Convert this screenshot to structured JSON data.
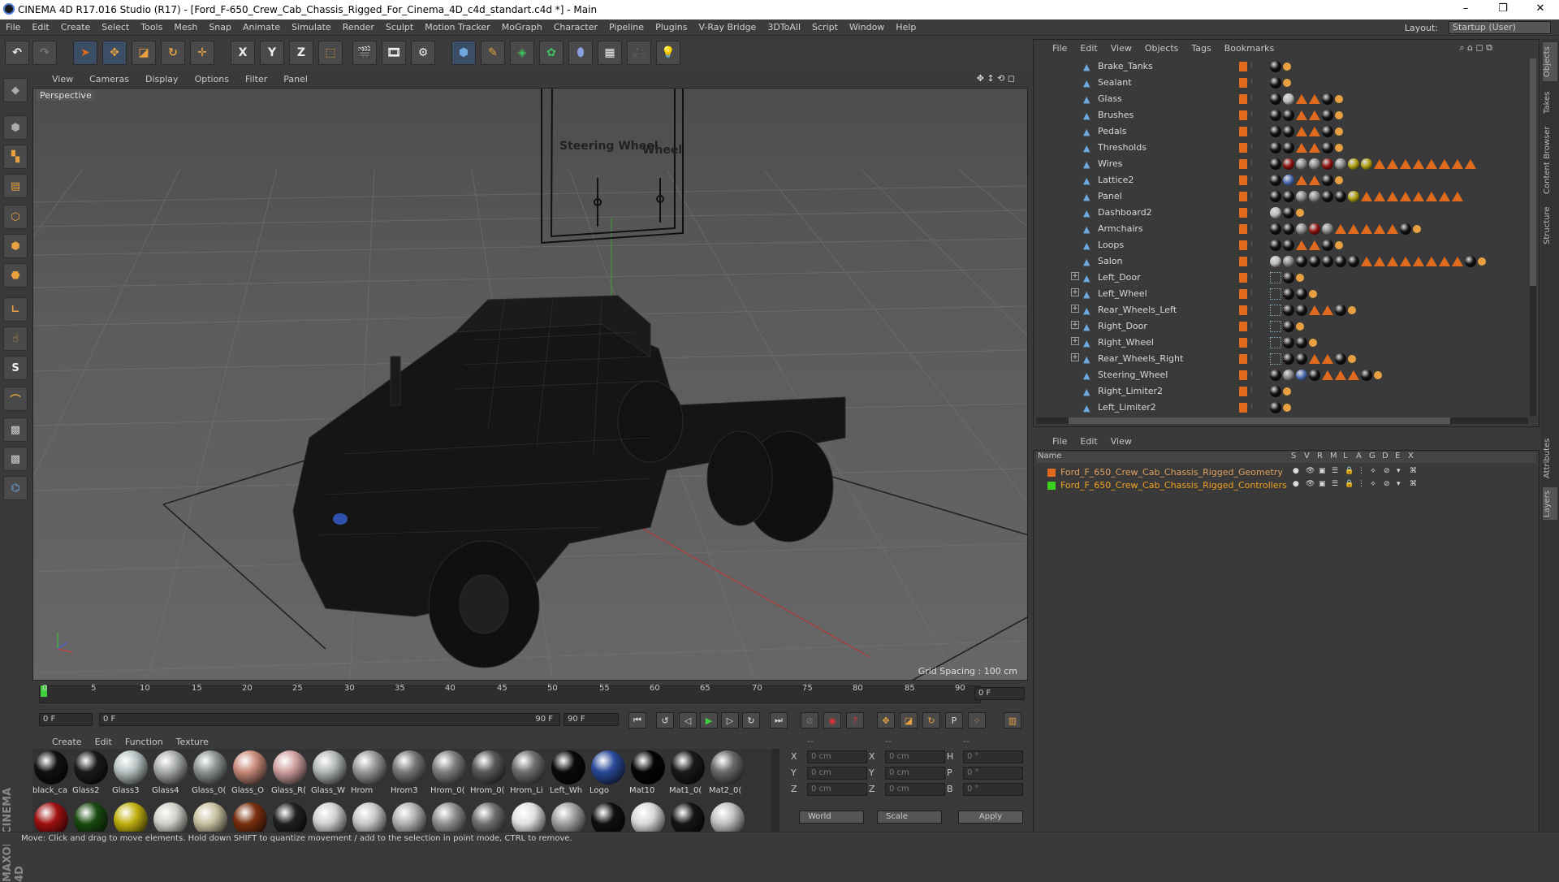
{
  "window": {
    "title": "CINEMA 4D R17.016 Studio (R17) - [Ford_F-650_Crew_Cab_Chassis_Rigged_For_Cinema_4D_c4d_standart.c4d *] - Main",
    "minimize": "–",
    "maximize": "❐",
    "close": "✕"
  },
  "menubar": {
    "items": [
      "File",
      "Edit",
      "Create",
      "Select",
      "Tools",
      "Mesh",
      "Snap",
      "Animate",
      "Simulate",
      "Render",
      "Sculpt",
      "Motion Tracker",
      "MoGraph",
      "Character",
      "Pipeline",
      "Plugins",
      "V-Ray Bridge",
      "3DToAll",
      "Script",
      "Window",
      "Help"
    ],
    "layout_label": "Layout:",
    "layout_value": "Startup (User)"
  },
  "toolbar": {
    "axis_x": "X",
    "axis_y": "Y",
    "axis_z": "Z"
  },
  "viewport": {
    "menu": [
      "View",
      "Cameras",
      "Display",
      "Options",
      "Filter",
      "Panel"
    ],
    "camera_label": "Perspective",
    "grid_spacing": "Grid Spacing : 100 cm",
    "sign_left": "Steering Wheel",
    "sign_right": "Wheel"
  },
  "timeline": {
    "ticks": [
      "0",
      "5",
      "10",
      "15",
      "20",
      "25",
      "30",
      "35",
      "40",
      "45",
      "50",
      "55",
      "60",
      "65",
      "70",
      "75",
      "80",
      "85",
      "90"
    ],
    "current_frame": "0 F",
    "start_field": "0 F",
    "range_start": "0 F",
    "range_end": "90 F",
    "end_field": "90 F"
  },
  "materials": {
    "menu": [
      "Create",
      "Edit",
      "Function",
      "Texture"
    ],
    "row1": [
      {
        "label": "black_ca",
        "color": "#111111"
      },
      {
        "label": "Glass2",
        "color": "#1a1a1a"
      },
      {
        "label": "Glass3",
        "color": "#b9c3c3"
      },
      {
        "label": "Glass4",
        "color": "#a9acac"
      },
      {
        "label": "Glass_0(",
        "color": "#8e9494"
      },
      {
        "label": "Glass_O",
        "color": "#c98a7a"
      },
      {
        "label": "Glass_R(",
        "color": "#d0a0a0"
      },
      {
        "label": "Glass_W",
        "color": "#b4b8b8"
      },
      {
        "label": "Hrom",
        "color": "#9a9a9a"
      },
      {
        "label": "Hrom3",
        "color": "#7a7a7a"
      },
      {
        "label": "Hrom_0(",
        "color": "#808080"
      },
      {
        "label": "Hrom_0(",
        "color": "#5a5a5a"
      },
      {
        "label": "Hrom_Li",
        "color": "#707070"
      },
      {
        "label": "Left_Wh",
        "color": "#0a0a0a"
      },
      {
        "label": "Logo",
        "color": "#2a4a9a"
      },
      {
        "label": "Mat10",
        "color": "#050505"
      },
      {
        "label": "Mat1_0(",
        "color": "#1a1a1a"
      },
      {
        "label": "Mat2_0(",
        "color": "#6a6a6a"
      }
    ],
    "row2": [
      "#a01010",
      "#1a4a10",
      "#c0b010",
      "#d0d0c8",
      "#c8c0a0",
      "#7a3010",
      "#202020",
      "#d0d0d0",
      "#c8c8c8",
      "#b0b0b0",
      "#909090",
      "#707070",
      "#e0e0e0",
      "#a0a0a0",
      "#101010",
      "#d8d8d8",
      "#151515",
      "#c0c0c0"
    ]
  },
  "coords": {
    "headers": [
      "--",
      "--",
      "--"
    ],
    "rows": [
      {
        "a": "X",
        "av": "0 cm",
        "b": "X",
        "bv": "0 cm",
        "c": "H",
        "cv": "0 °"
      },
      {
        "a": "Y",
        "av": "0 cm",
        "b": "Y",
        "bv": "0 cm",
        "c": "P",
        "cv": "0 °"
      },
      {
        "a": "Z",
        "av": "0 cm",
        "b": "Z",
        "bv": "0 cm",
        "c": "B",
        "cv": "0 °"
      }
    ],
    "world": "World",
    "scale": "Scale",
    "apply": "Apply"
  },
  "objects": {
    "menu": [
      "File",
      "Edit",
      "View",
      "Objects",
      "Tags",
      "Bookmarks"
    ],
    "rows": [
      {
        "name": "Brake_Tanks",
        "tags": "ko"
      },
      {
        "name": "Sealant",
        "tags": "ko"
      },
      {
        "name": "Glass",
        "tags": "klttko"
      },
      {
        "name": "Brushes",
        "tags": "kkttko"
      },
      {
        "name": "Pedals",
        "tags": "kkttko"
      },
      {
        "name": "Thresholds",
        "tags": "kkttko"
      },
      {
        "name": "Wires",
        "tags": "krggrgyytttttttt"
      },
      {
        "name": "Lattice2",
        "tags": "kbttko"
      },
      {
        "name": "Panel",
        "tags": "kkggkkytttttttt"
      },
      {
        "name": "Dashboard2",
        "tags": "lko"
      },
      {
        "name": "Armchairs",
        "tags": "kkgrgtttttko"
      },
      {
        "name": "Loops",
        "tags": "kkttko"
      },
      {
        "name": "Salon",
        "tags": "lgkkkkkttttttttko"
      },
      {
        "name": "Left_Door",
        "tags": "nko",
        "expand": true
      },
      {
        "name": "Left_Wheel",
        "tags": "nkko",
        "expand": true
      },
      {
        "name": "Rear_Wheels_Left",
        "tags": "nkkttko",
        "expand": true
      },
      {
        "name": "Right_Door",
        "tags": "nko",
        "expand": true
      },
      {
        "name": "Right_Wheel",
        "tags": "nkko",
        "expand": true
      },
      {
        "name": "Rear_Wheels_Right",
        "tags": "nkkttko",
        "expand": true
      },
      {
        "name": "Steering_Wheel",
        "tags": "kgbktttko"
      },
      {
        "name": "Right_Limiter2",
        "tags": "ko"
      },
      {
        "name": "Left_Limiter2",
        "tags": "ko"
      }
    ]
  },
  "layers": {
    "menu": [
      "File",
      "Edit",
      "View"
    ],
    "header": {
      "name": "Name",
      "cols": [
        "S",
        "V",
        "R",
        "M",
        "L",
        "A",
        "G",
        "D",
        "E",
        "X"
      ]
    },
    "rows": [
      {
        "name": "Ford_F_650_Crew_Cab_Chassis_Rigged_Geometry",
        "color": "#e06b1f",
        "text": "#e0a060"
      },
      {
        "name": "Ford_F_650_Crew_Cab_Chassis_Rigged_Controllers",
        "color": "#3cd020",
        "text": "#f0a020"
      }
    ]
  },
  "right_tabs": [
    "Objects",
    "Takes",
    "Content Browser",
    "Structure",
    "Attributes",
    "Layers"
  ],
  "status": "Move: Click and drag to move elements. Hold down SHIFT to quantize movement / add to the selection in point mode, CTRL to remove.",
  "branding": "MAXON CINEMA 4D"
}
